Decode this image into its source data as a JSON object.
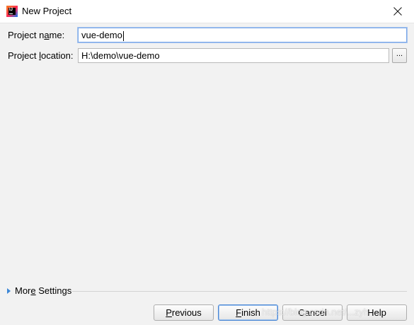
{
  "window": {
    "title": "New Project",
    "app_icon": "intellij-idea-icon",
    "app_icon_text": "IJ"
  },
  "form": {
    "project_name_label_pre": "Project n",
    "project_name_label_mn": "a",
    "project_name_label_post": "me:",
    "project_name_value": "vue-demo",
    "project_location_label_pre": "Project ",
    "project_location_label_mn": "l",
    "project_location_label_post": "ocation:",
    "project_location_value": "H:\\demo\\vue-demo",
    "browse_label": "..."
  },
  "more_settings": {
    "label_pre": "Mor",
    "label_mn": "e",
    "label_post": " Settings",
    "expanded": false
  },
  "buttons": {
    "previous_mn": "P",
    "previous_rest": "revious",
    "finish_mn": "F",
    "finish_rest": "inish",
    "cancel": "Cancel",
    "help": "Help"
  },
  "watermark": "https://blog.csdn.net/...zyh",
  "colors": {
    "accent": "#3d87d6",
    "focus_border": "#7aa7e8",
    "background": "#f2f2f2"
  }
}
